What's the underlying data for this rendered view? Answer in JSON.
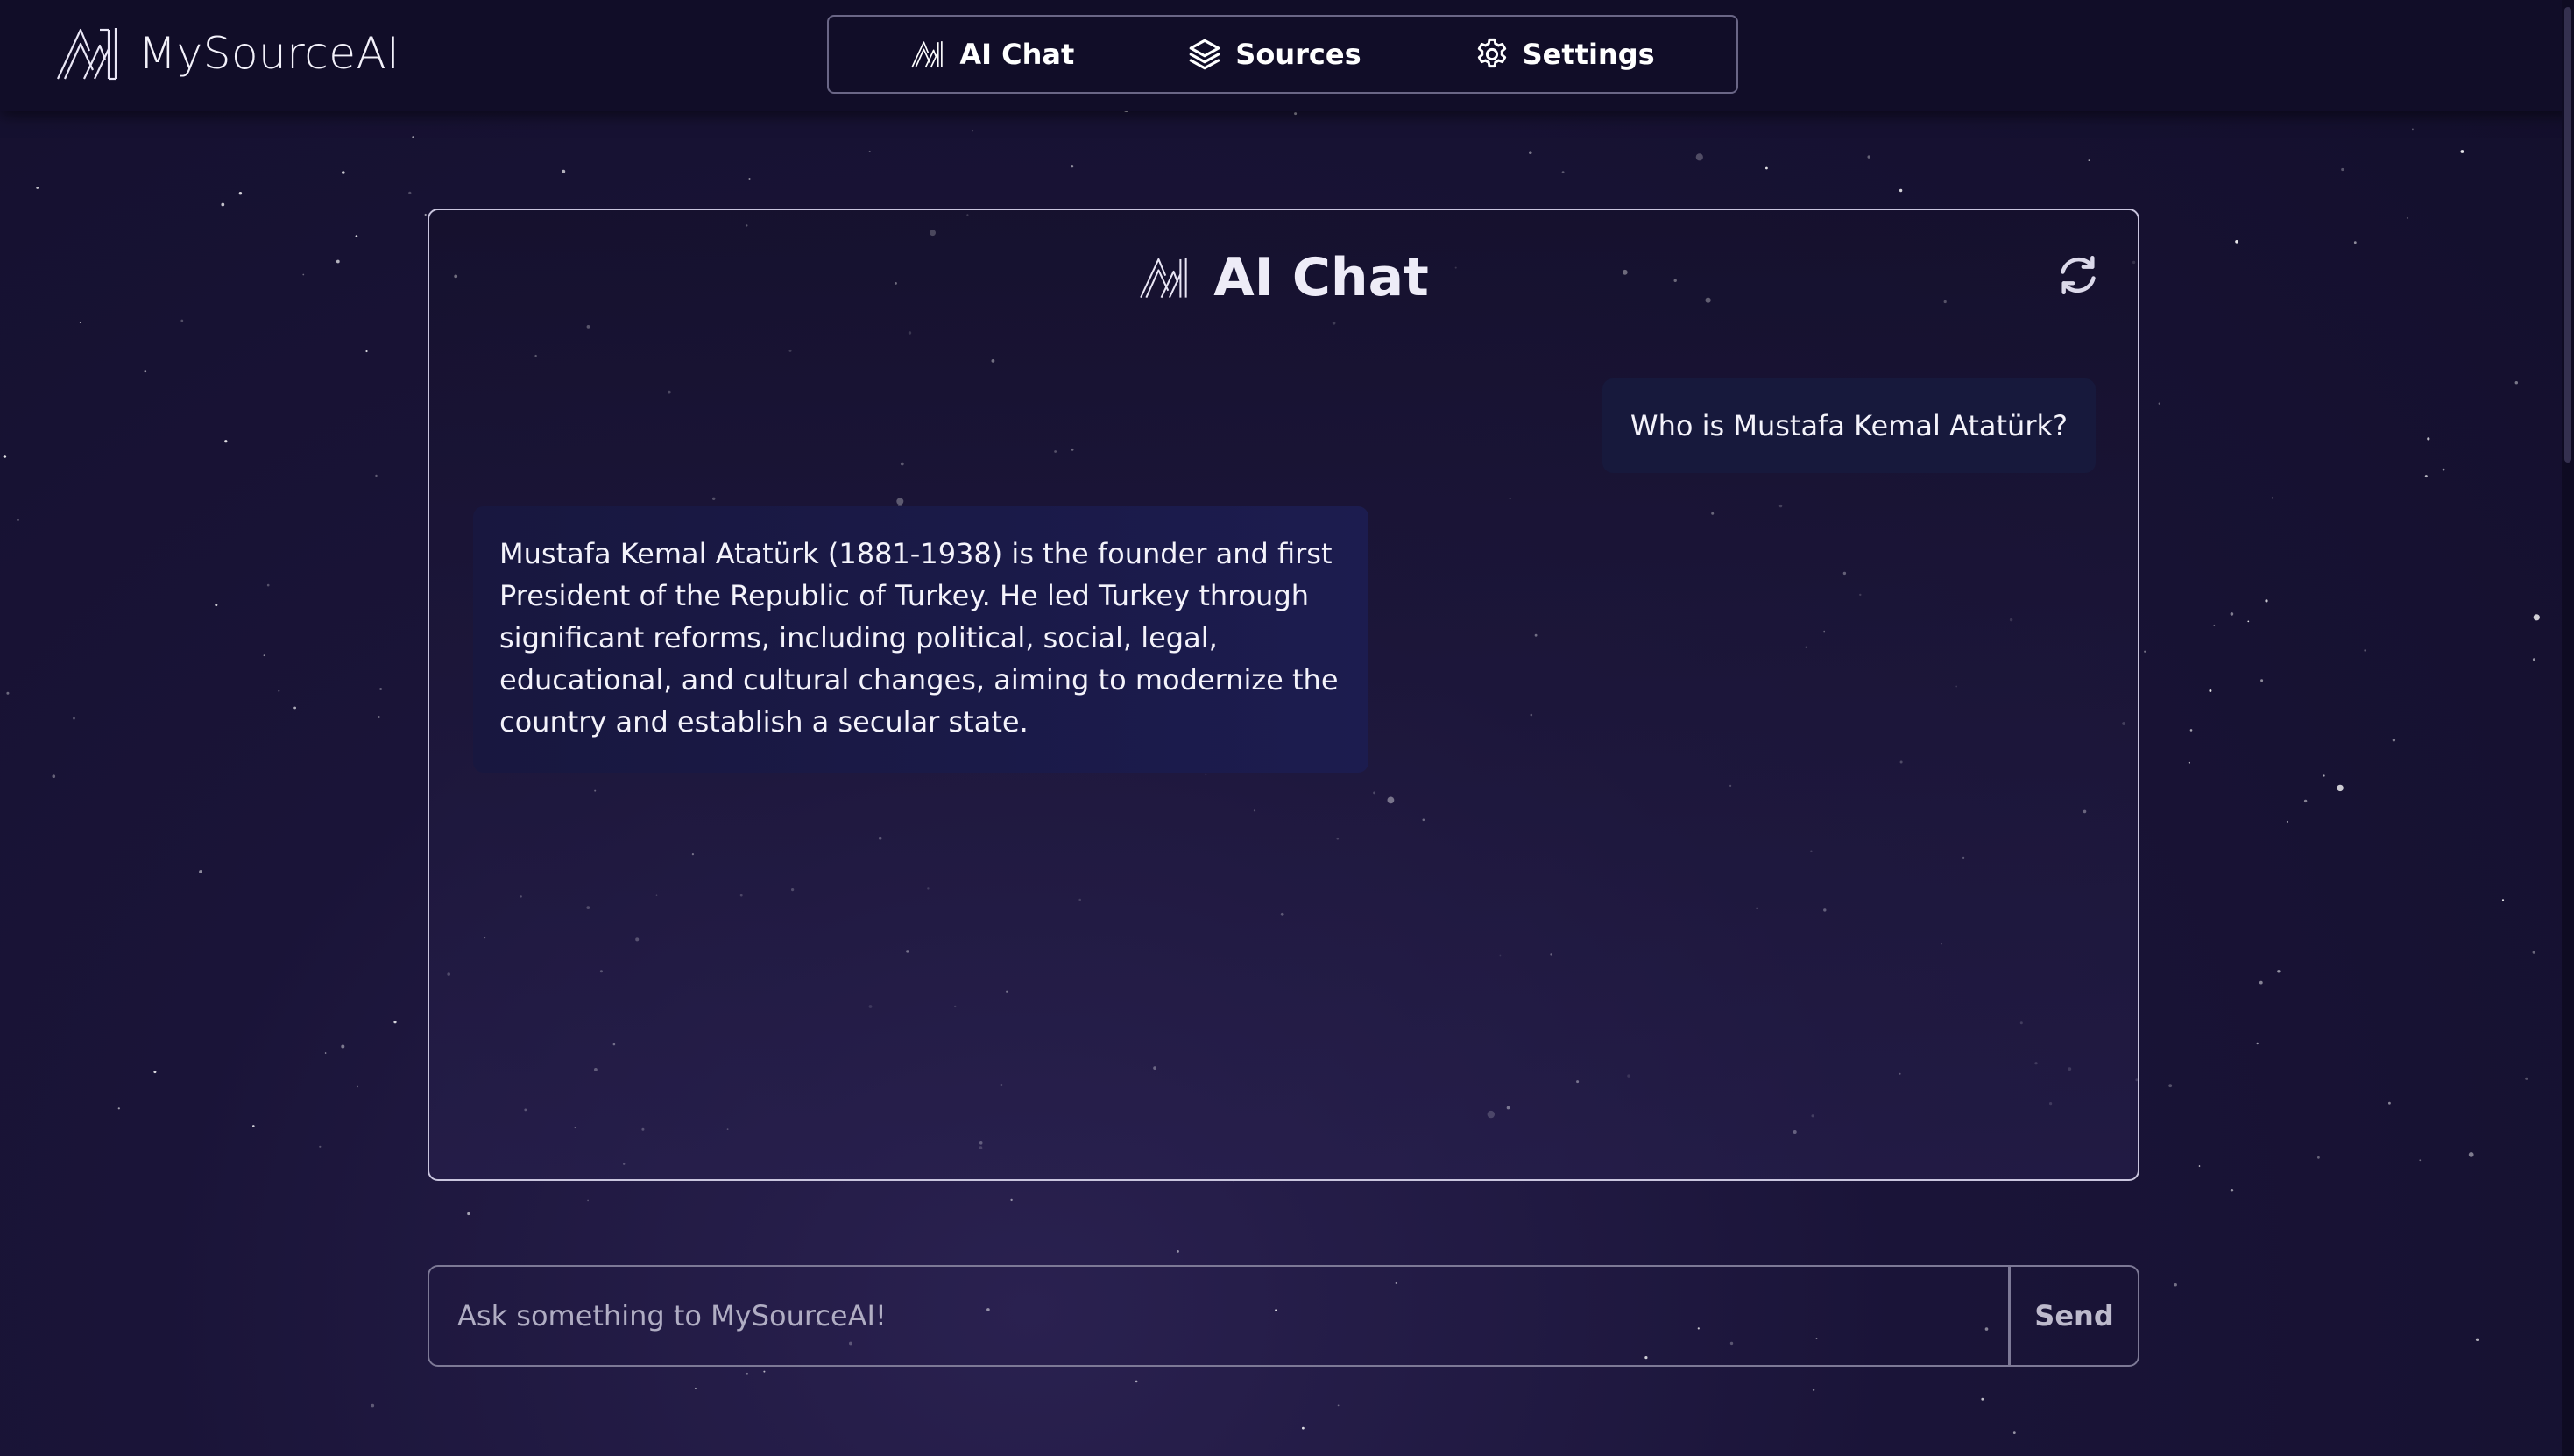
{
  "brand": {
    "name": "MySourceAI",
    "logo": "mysourceai-logo"
  },
  "nav": {
    "items": [
      {
        "label": "AI Chat",
        "icon": "mysourceai-logo-icon"
      },
      {
        "label": "Sources",
        "icon": "layers-icon"
      },
      {
        "label": "Settings",
        "icon": "gear-icon"
      }
    ]
  },
  "chat": {
    "title": "AI Chat",
    "refresh_icon": "refresh-icon",
    "messages": [
      {
        "role": "user",
        "text": "Who is Mustafa Kemal Atatürk?"
      },
      {
        "role": "assistant",
        "text": "Mustafa Kemal Atatürk (1881-1938) is the founder and first President of the Republic of Turkey. He led Turkey through significant reforms, including political, social, legal, educational, and cultural changes, aiming to modernize the country and establish a secular state."
      }
    ]
  },
  "composer": {
    "placeholder": "Ask something to MySourceAI!",
    "value": "",
    "send_label": "Send"
  },
  "colors": {
    "background": "#130f2c",
    "topbar": "#110d28",
    "user_bubble": "#17193c",
    "assistant_bubble": "#1c1c4f",
    "panel_border": "#c9c5de"
  }
}
